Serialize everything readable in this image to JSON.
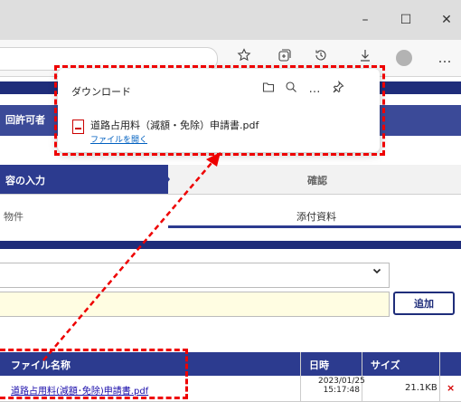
{
  "window": {
    "minimize": "–",
    "maximize": "☐",
    "close": "✕"
  },
  "toolbar": {
    "fav_icon": "star-add-icon",
    "collections_icon": "collections-icon",
    "history_icon": "history-icon",
    "download_icon": "download-icon",
    "more": "…"
  },
  "download_panel": {
    "title": "ダウンロード",
    "file_name": "道路占用料（減額・免除）申請書.pdf",
    "open_link": "ファイルを開く",
    "more": "…"
  },
  "page": {
    "header_text": "回許可者",
    "step_current": "容の入力",
    "step_next": "確認",
    "tab_left": "物件",
    "tab_right": "添付資料",
    "add_button": "追加"
  },
  "table": {
    "headers": [
      "ファイル名称",
      "日時",
      "サイズ"
    ],
    "rows": [
      {
        "file": "道路占用料(減額･免除)申請書.pdf",
        "date": "2023/01/25",
        "time": "15:17:48",
        "size": "21.1KB",
        "delete": "×"
      }
    ]
  },
  "colors": {
    "navy": "#1f2d7a",
    "highlight_red": "#e00000"
  }
}
